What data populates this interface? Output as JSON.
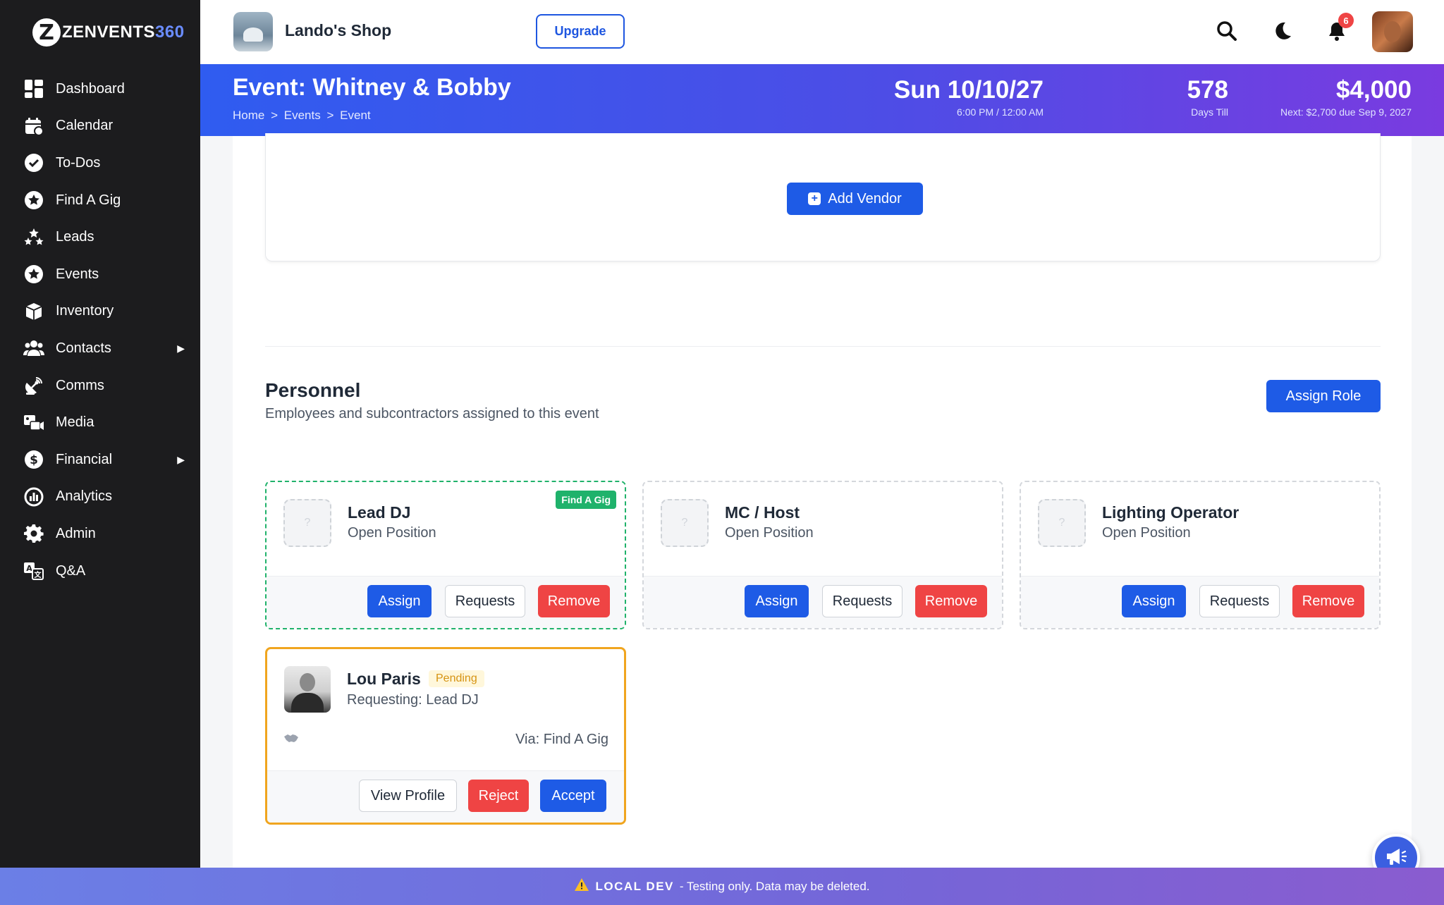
{
  "logo": {
    "badge": "Z",
    "text_main": "ZENVENTS",
    "text_accent": "360"
  },
  "sidebar": {
    "items": [
      {
        "label": "Dashboard",
        "icon": "dashboard-icon"
      },
      {
        "label": "Calendar",
        "icon": "calendar-icon"
      },
      {
        "label": "To-Dos",
        "icon": "check-circle-icon"
      },
      {
        "label": "Find A Gig",
        "icon": "star-circle-icon"
      },
      {
        "label": "Leads",
        "icon": "stars-icon"
      },
      {
        "label": "Events",
        "icon": "star-circle-icon"
      },
      {
        "label": "Inventory",
        "icon": "box-icon"
      },
      {
        "label": "Contacts",
        "icon": "users-icon",
        "caret": "▶"
      },
      {
        "label": "Comms",
        "icon": "satellite-icon"
      },
      {
        "label": "Media",
        "icon": "media-icon"
      },
      {
        "label": "Financial",
        "icon": "dollar-icon",
        "caret": "▶"
      },
      {
        "label": "Analytics",
        "icon": "analytics-icon"
      },
      {
        "label": "Admin",
        "icon": "gear-icon"
      },
      {
        "label": "Q&A",
        "icon": "translate-icon"
      }
    ]
  },
  "topbar": {
    "shop_name": "Lando's Shop",
    "upgrade_label": "Upgrade",
    "notification_count": "6"
  },
  "event": {
    "title": "Event: Whitney & Bobby",
    "breadcrumb": [
      "Home",
      ">",
      "Events",
      ">",
      "Event"
    ],
    "date": "Sun 10/10/27",
    "time": "6:00 PM / 12:00 AM",
    "days_till": "578",
    "days_till_label": "Days Till",
    "amount": "$4,000",
    "next_payment": "Next: $2,700 due Sep 9, 2027"
  },
  "vendors": {
    "add_label": "Add Vendor"
  },
  "personnel": {
    "title": "Personnel",
    "subtitle": "Employees and subcontractors assigned to this event",
    "assign_role_label": "Assign Role",
    "roles": [
      {
        "name": "Lead DJ",
        "status": "Open Position",
        "tag": "Find A Gig"
      },
      {
        "name": "MC / Host",
        "status": "Open Position"
      },
      {
        "name": "Lighting Operator",
        "status": "Open Position"
      }
    ],
    "buttons": {
      "assign": "Assign",
      "requests": "Requests",
      "remove": "Remove"
    },
    "placeholder_glyph": "?",
    "request": {
      "name": "Lou Paris",
      "badge": "Pending",
      "requesting": "Requesting: Lead DJ",
      "via": "Via: Find A Gig",
      "view_profile": "View Profile",
      "reject": "Reject",
      "accept": "Accept"
    }
  },
  "devbar": {
    "label": "LOCAL DEV",
    "message": "- Testing only. Data may be deleted."
  },
  "colors": {
    "primary": "#1e5be6",
    "danger": "#ef4444",
    "success": "#1fb26b",
    "warning": "#f0a51f",
    "sidebar": "#1c1c1e"
  }
}
